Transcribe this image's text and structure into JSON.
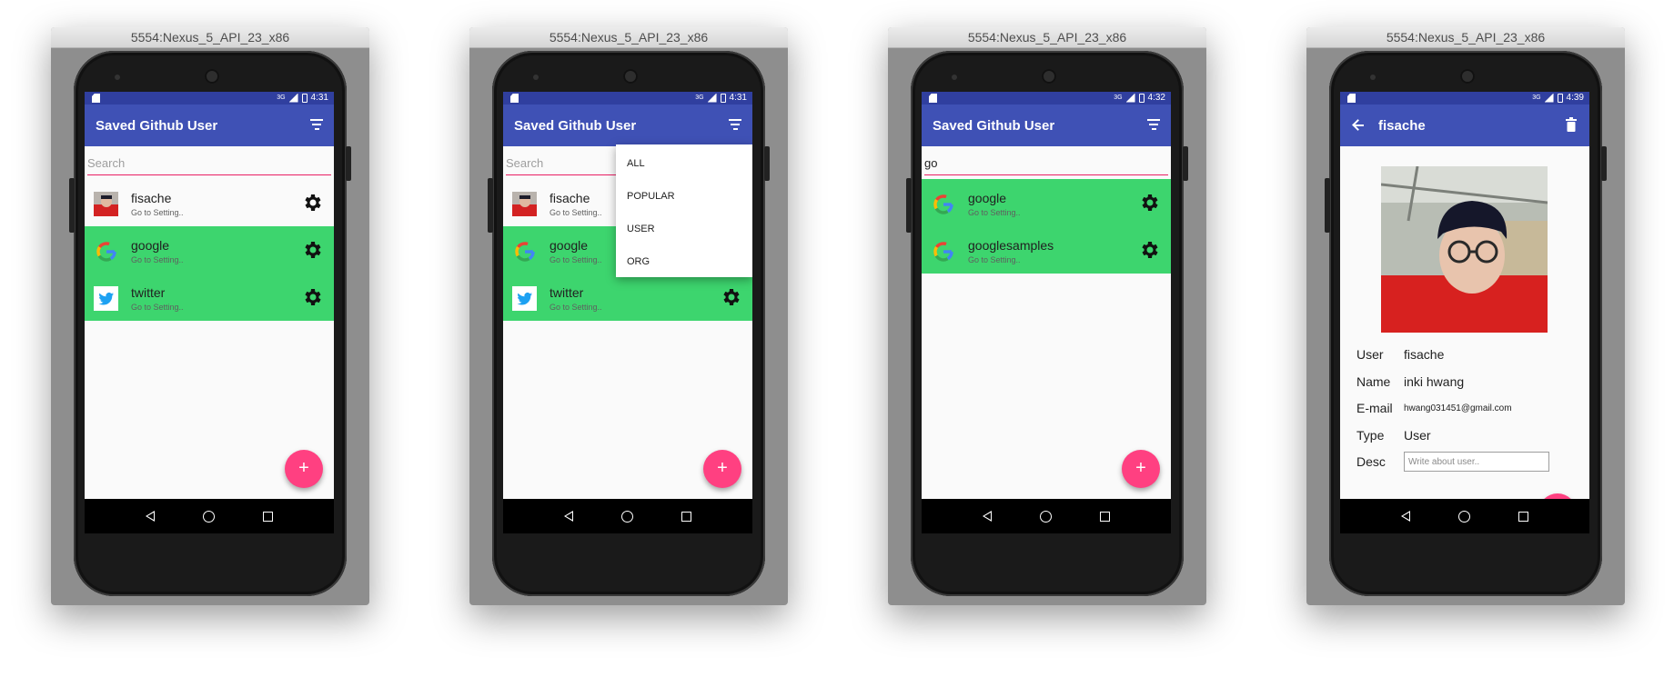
{
  "emulator_title": "5554:Nexus_5_API_23_x86",
  "colors": {
    "primary": "#3f51b5",
    "primary_dark": "#303f9f",
    "accent": "#ff4081",
    "org_row": "#3dd56e",
    "search_underline": "#e91e63"
  },
  "screens": [
    {
      "time": "4:31",
      "app_title": "Saved Github User",
      "search": {
        "value": "",
        "placeholder": "Search"
      },
      "users": [
        {
          "name": "fisache",
          "subtitle": "Go to Setting..",
          "avatar": "user-photo-icon"
        },
        {
          "name": "google",
          "subtitle": "Go to Setting..",
          "avatar": "google-logo-icon"
        },
        {
          "name": "twitter",
          "subtitle": "Go to Setting..",
          "avatar": "twitter-logo-icon"
        }
      ],
      "fab": "+"
    },
    {
      "time": "4:31",
      "app_title": "Saved Github User",
      "search": {
        "value": "",
        "placeholder": "Search"
      },
      "users": [
        {
          "name": "fisache",
          "subtitle": "Go to Setting.."
        },
        {
          "name": "google",
          "subtitle": "Go to Setting.."
        },
        {
          "name": "twitter",
          "subtitle": "Go to Setting.."
        }
      ],
      "filter_menu": [
        "ALL",
        "POPULAR",
        "USER",
        "ORG"
      ],
      "fab": "+"
    },
    {
      "time": "4:32",
      "app_title": "Saved Github User",
      "search": {
        "value": "go",
        "placeholder": "Search"
      },
      "users": [
        {
          "name": "google",
          "subtitle": "Go to Setting.."
        },
        {
          "name": "googlesamples",
          "subtitle": "Go to Setting.."
        }
      ],
      "fab": "+"
    },
    {
      "time": "4:39",
      "app_title": "fisache",
      "details": {
        "user_label": "User",
        "user_value": "fisache",
        "name_label": "Name",
        "name_value": "inki hwang",
        "email_label": "E-mail",
        "email_value": "hwang031451@gmail.com",
        "type_label": "Type",
        "type_value": "User",
        "desc_label": "Desc",
        "desc_placeholder": "Write about user.."
      }
    }
  ]
}
